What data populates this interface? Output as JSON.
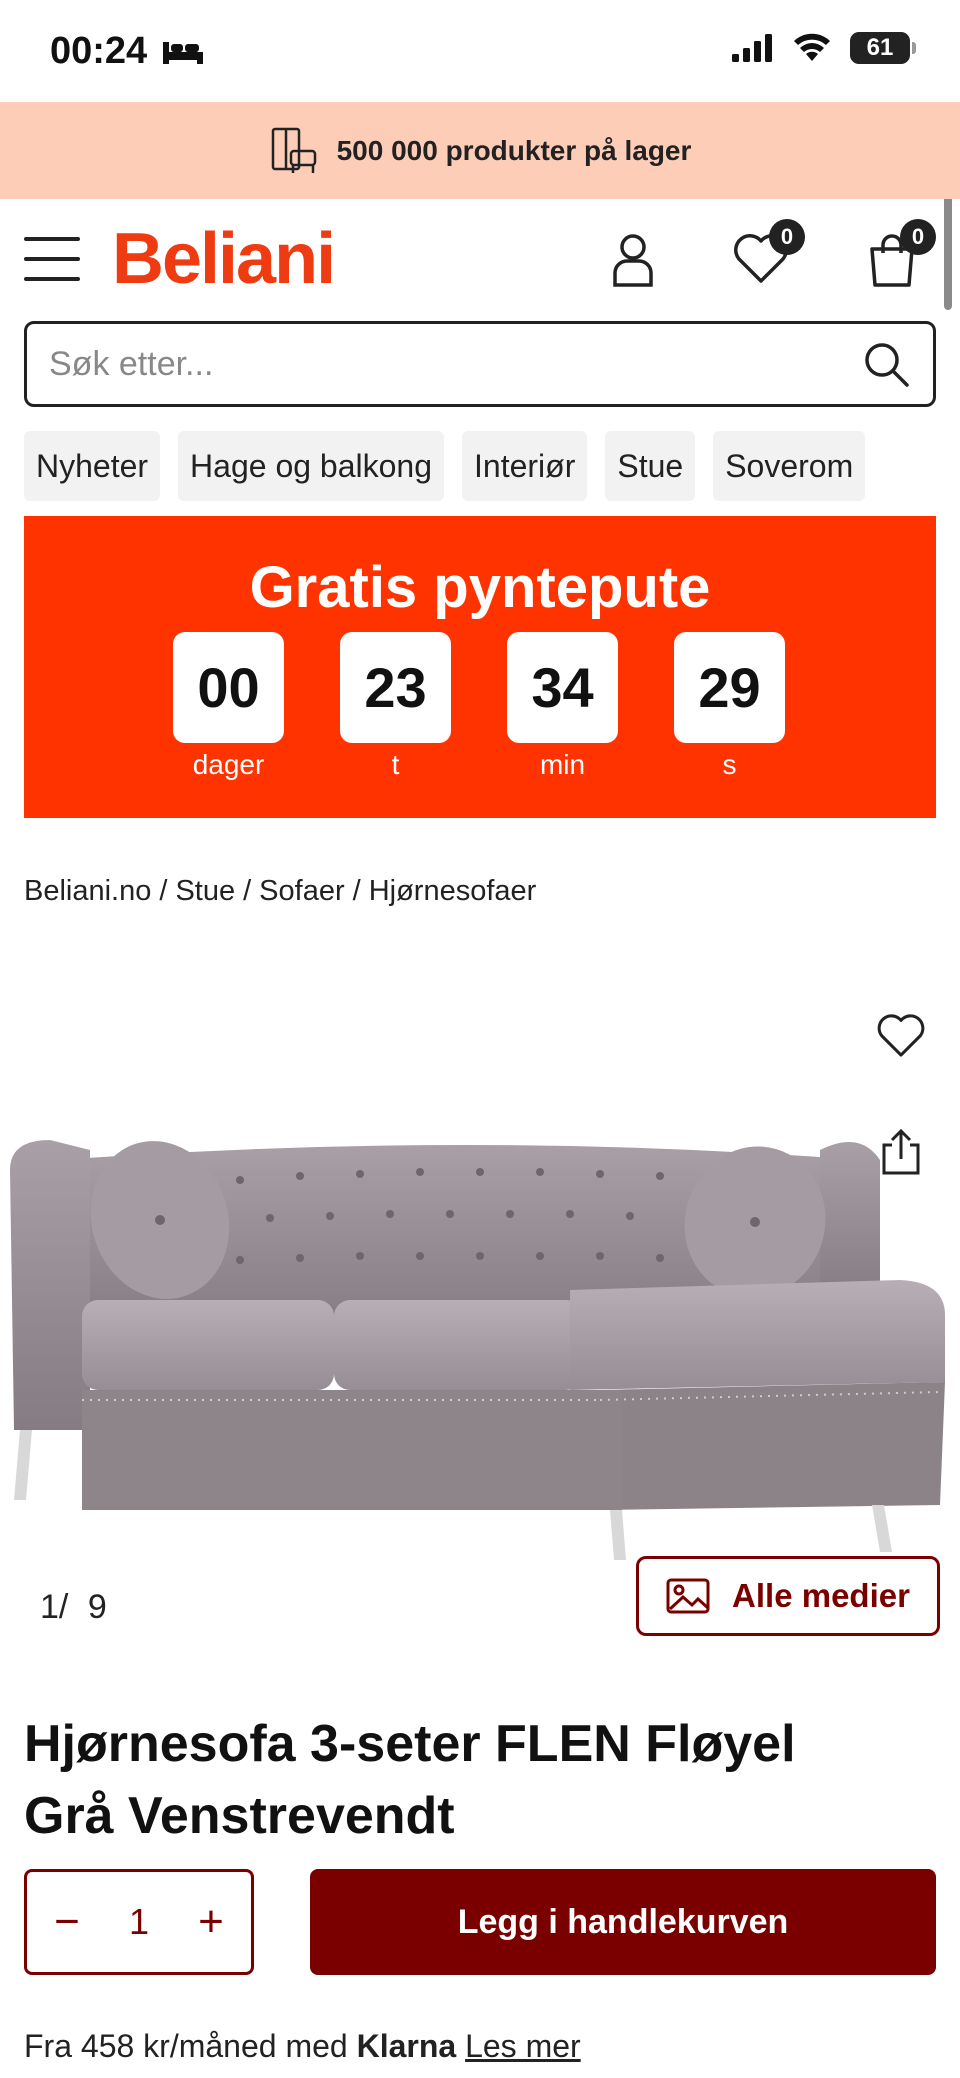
{
  "status_bar": {
    "time": "00:24",
    "battery": "61"
  },
  "promo": {
    "text": "500 000 produkter på lager"
  },
  "header": {
    "logo": "Beliani",
    "wishlist_count": "0",
    "cart_count": "0"
  },
  "search": {
    "placeholder": "Søk etter..."
  },
  "nav": {
    "items": [
      "Nyheter",
      "Hage og balkong",
      "Interiør",
      "Stue",
      "Soverom"
    ]
  },
  "countdown": {
    "title": "Gratis pyntepute",
    "units": [
      {
        "value": "00",
        "label": "dager"
      },
      {
        "value": "23",
        "label": "t"
      },
      {
        "value": "34",
        "label": "min"
      },
      {
        "value": "29",
        "label": "s"
      }
    ]
  },
  "breadcrumb": {
    "items": [
      "Beliani.no",
      "Stue",
      "Sofaer",
      "Hjørnesofaer"
    ]
  },
  "gallery": {
    "current": "1/",
    "total": "9",
    "all_media_label": "Alle medier"
  },
  "product": {
    "title_line1": "Hjørnesofa 3-seter FLEN Fløyel",
    "title_line2": "Grå Venstrevendt",
    "quantity": "1",
    "add_to_cart_label": "Legg i handlekurven",
    "klarna_prefix": "Fra 458 kr/måned med",
    "klarna_brand": "Klarna",
    "klarna_link": "Les mer"
  },
  "colors": {
    "brand": "#ee3b12",
    "countdown_bg": "#ff3300",
    "promo_bg": "#fdcdb7",
    "primary_button": "#7a0000"
  }
}
